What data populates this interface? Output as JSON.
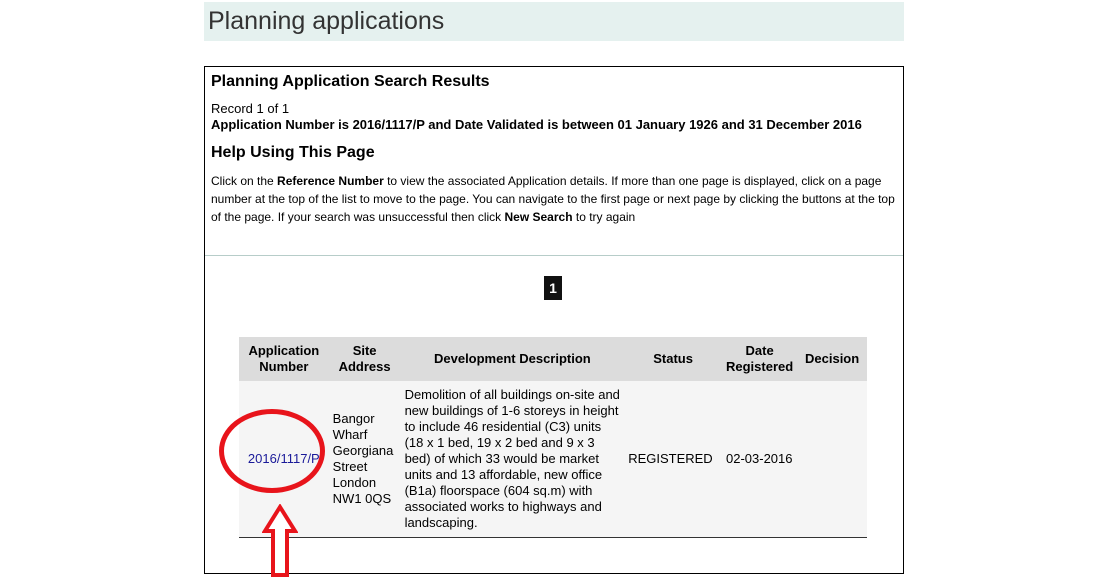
{
  "page": {
    "title": "Planning applications"
  },
  "results": {
    "heading": "Planning Application Search Results",
    "record_info": "Record 1 of 1",
    "criteria": "Application Number is 2016/1117/P and Date Validated is between 01 January 1926 and 31 December 2016"
  },
  "help": {
    "heading": "Help Using This Page",
    "text_1": "Click on the ",
    "bold_1": "Reference Number",
    "text_2": " to view the associated Application details. If more than one page is displayed, click on a page number at the top of the list to move to the page. You can navigate to the first page or next page by clicking the buttons at the top of the page. If your search was unsuccessful then click ",
    "bold_2": "New Search",
    "text_3": " to try again"
  },
  "pager": {
    "current": "1"
  },
  "table": {
    "headers": {
      "app_number_1": "Application",
      "app_number_2": "Number",
      "site_1": "Site",
      "site_2": "Address",
      "description": "Development Description",
      "status": "Status",
      "date_1": "Date",
      "date_2": "Registered",
      "decision": "Decision"
    },
    "rows": [
      {
        "app_number": "2016/1117/P",
        "address": [
          "Bangor",
          "Wharf",
          "Georgiana",
          "Street",
          "London",
          "NW1 0QS"
        ],
        "description": "Demolition of all buildings on-site and new buildings of 1-6 storeys in height to include 46 residential (C3) units (18 x 1 bed, 19 x 2 bed and 9 x 3 bed) of which 33 would be market units and 13 affordable, new office (B1a) floorspace (604 sq.m) with associated works to highways and landscaping.",
        "status": "REGISTERED",
        "date_registered": "02-03-2016",
        "decision": ""
      }
    ]
  },
  "annotation": {
    "color": "#e8141b"
  }
}
